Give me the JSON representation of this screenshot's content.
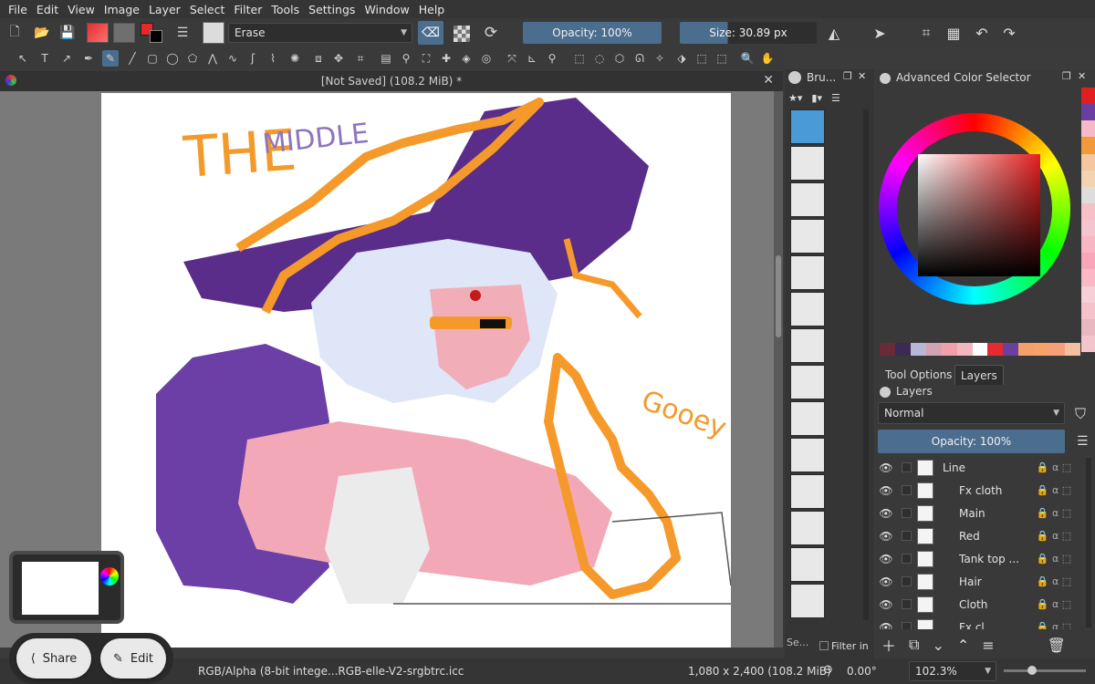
{
  "menu": [
    "File",
    "Edit",
    "View",
    "Image",
    "Layer",
    "Select",
    "Filter",
    "Tools",
    "Settings",
    "Window",
    "Help"
  ],
  "toolbar": {
    "preset_name": "Erase",
    "opacity_label": "Opacity: 100%",
    "size_label": "Size: 30.89 px",
    "foreground_color": "#e8262b",
    "background_color": "#ffffff"
  },
  "document": {
    "title": "[Not Saved]  (108.2 MiB) *"
  },
  "artwork": {
    "text_the": "THE",
    "text_middle": "MIDDLE",
    "text_gooey": "Gooey"
  },
  "brush_docker": {
    "title": "Bru..."
  },
  "color_docker": {
    "title": "Advanced Color Selector",
    "swatches": [
      "#e02020",
      "#6a3fa0",
      "#f7b9c8",
      "#f29a3a",
      "#f4c7a0",
      "#f4d3b0",
      "#ddd",
      "#f6c0c8",
      "#f4c5cf",
      "#f7b6c2",
      "#f8a6b8",
      "#f9b8c4",
      "#f6d0d6",
      "#f4c2c8",
      "#e8b7c0",
      "#f2c4cc"
    ],
    "recent": [
      "#6b2a3a",
      "#3a2a55",
      "#b7b7d8",
      "#d4a3b3",
      "#f1a0a9",
      "#f3b6bf",
      "#ffffff",
      "#e52b32",
      "#6a3fa0",
      "#f4a06a",
      "#f7a26a",
      "#f6a07a",
      "#f4c0a0"
    ]
  },
  "layers_panel": {
    "tab_tool_options": "Tool Options",
    "tab_layers": "Layers",
    "title": "Layers",
    "blend_mode": "Normal",
    "opacity_label": "Opacity:  100%",
    "filter_label": "Filter in",
    "search_placeholder": "Se...",
    "layers": [
      {
        "name": "Line",
        "group": true
      },
      {
        "name": "Fx cloth"
      },
      {
        "name": "Main"
      },
      {
        "name": "Red"
      },
      {
        "name": "Tank top ..."
      },
      {
        "name": "Hair"
      },
      {
        "name": "Cloth"
      },
      {
        "name": "Fx cl..."
      }
    ]
  },
  "status": {
    "color_profile": "RGB/Alpha (8-bit intege...RGB-elle-V2-srgbtrc.icc",
    "dimensions": "1,080 x 2,400 (108.2 MiB)",
    "rotation": "0.00°",
    "zoom": "102.3%"
  },
  "overlay": {
    "share_label": "Share",
    "edit_label": "Edit"
  }
}
